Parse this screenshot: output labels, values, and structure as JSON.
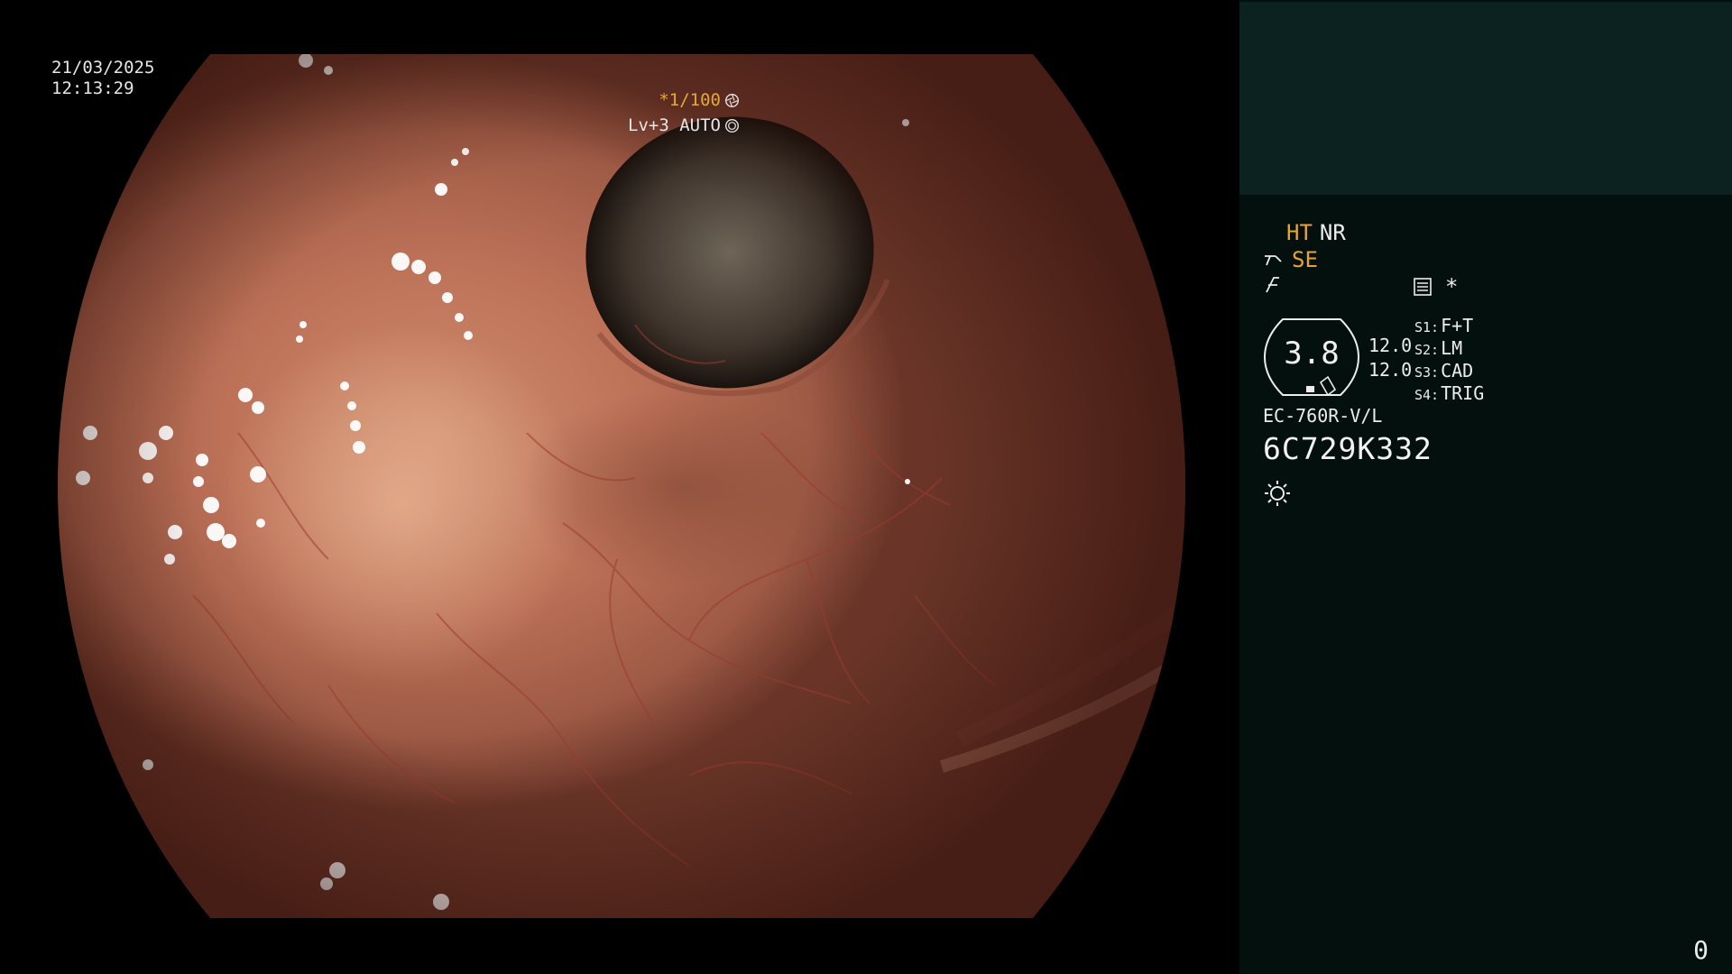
{
  "overlay": {
    "date": "21/03/2025",
    "time": "12:13:29",
    "shutter": "*1/100",
    "iris": "Lv+3 AUTO"
  },
  "panel": {
    "ht_label": "HT",
    "nr_label": "NR",
    "se_label": "SE",
    "memory_marker": "*",
    "brightness_value": "3.8",
    "levels": [
      "12.0",
      "12.0"
    ],
    "switches": [
      {
        "key": "S1:",
        "value": "F+T"
      },
      {
        "key": "S2:",
        "value": "LM"
      },
      {
        "key": "S3:",
        "value": "CAD"
      },
      {
        "key": "S4:",
        "value": "TRIG"
      }
    ],
    "scope_model": "EC-760R-V/L",
    "scope_serial": "6C729K332",
    "frame_count": "0"
  },
  "colors": {
    "accent_orange": "#e8a431",
    "panel_header": "#0c2220",
    "panel_body": "#04100e",
    "mucosa": "#bd7258"
  },
  "icons": {
    "shutter": "aperture-icon",
    "iris": "iris-icon",
    "se": "scope-tip-icon",
    "enhance": "enhance-icon",
    "memory": "memory-card-icon",
    "light": "light-source-icon"
  }
}
